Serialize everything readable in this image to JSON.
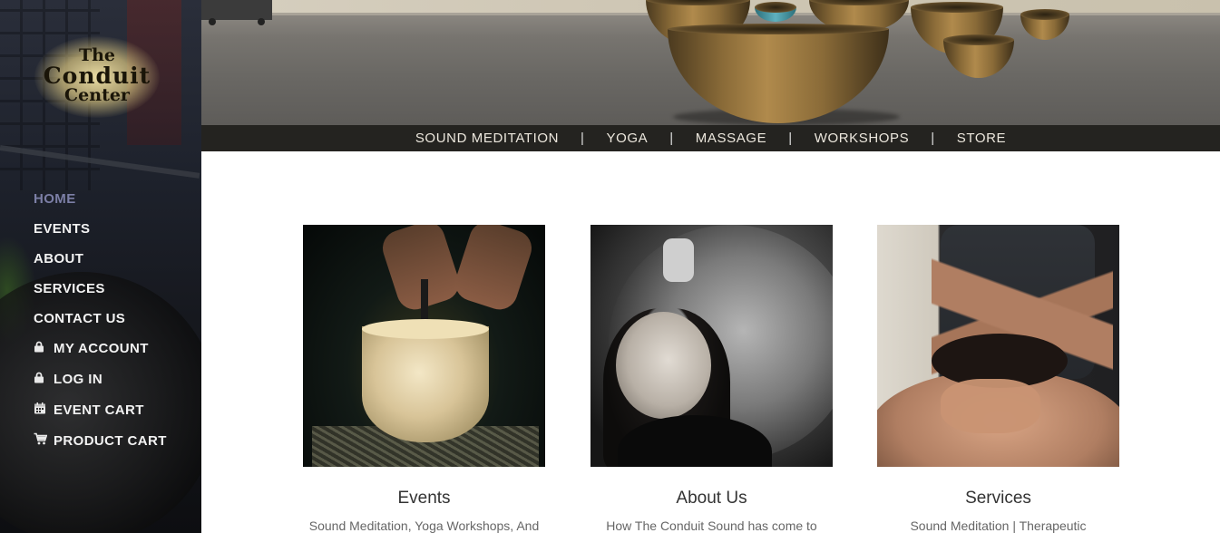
{
  "logo": {
    "line1": "The",
    "line2": "Conduit",
    "line3": "Center"
  },
  "sidebar": {
    "items": [
      {
        "label": "HOME",
        "active": true,
        "icon": ""
      },
      {
        "label": "EVENTS",
        "icon": ""
      },
      {
        "label": "ABOUT",
        "icon": ""
      },
      {
        "label": "SERVICES",
        "icon": ""
      },
      {
        "label": "CONTACT US",
        "icon": ""
      },
      {
        "label": "MY ACCOUNT",
        "icon": "lock-icon"
      },
      {
        "label": "LOG IN",
        "icon": "lock-icon"
      },
      {
        "label": "EVENT CART",
        "icon": "calendar-icon"
      },
      {
        "label": "PRODUCT CART",
        "icon": "cart-icon"
      }
    ]
  },
  "topnav": {
    "items": [
      "SOUND MEDITATION",
      "YOGA",
      "MASSAGE",
      "WORKSHOPS",
      "STORE"
    ],
    "separator": "|"
  },
  "cards": [
    {
      "title": "Events",
      "text": "Sound Meditation, Yoga Workshops, And"
    },
    {
      "title": "About Us",
      "text": "How The Conduit Sound has come to"
    },
    {
      "title": "Services",
      "text": "Sound Meditation | Therapeutic"
    }
  ],
  "colors": {
    "active_nav": "#7c7fa6",
    "topnav_bg": "#242320",
    "sidebar_bg": "#16181e"
  }
}
